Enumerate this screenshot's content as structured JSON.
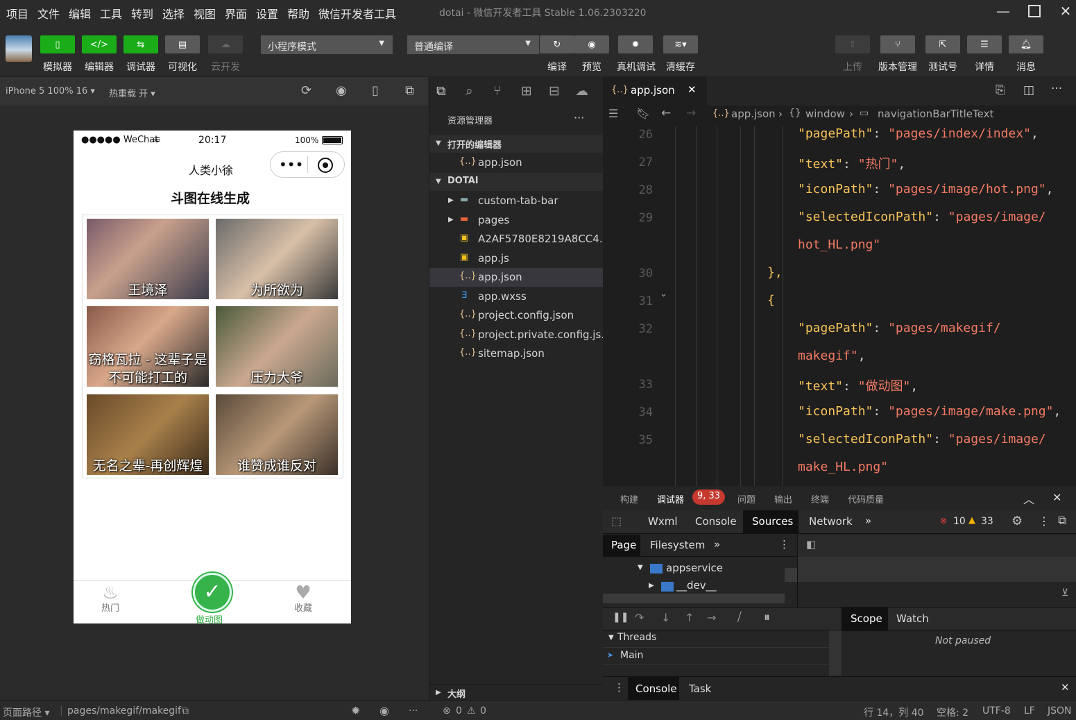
{
  "menu": [
    "项目",
    "文件",
    "编辑",
    "工具",
    "转到",
    "选择",
    "视图",
    "界面",
    "设置",
    "帮助",
    "微信开发者工具"
  ],
  "window_title": "dotai - 微信开发者工具 Stable 1.06.2303220",
  "toolbar": {
    "simulator": "模拟器",
    "editor": "编辑器",
    "debugger": "调试器",
    "visual": "可视化",
    "cloud": "云开发",
    "mode_select": "小程序模式",
    "compile_select": "普通编译",
    "compile": "编译",
    "preview": "预览",
    "remote_debug": "真机调试",
    "clear_cache": "清缓存",
    "upload": "上传",
    "version": "版本管理",
    "test": "测试号",
    "details": "详情",
    "messages": "消息"
  },
  "subbar": {
    "device": "iPhone 5 100% 16 ▾",
    "hotreload": "热重载 开 ▾"
  },
  "phone": {
    "status_left": "●●●●● WeChat",
    "status_time": "20:17",
    "status_battery": "100%",
    "nav_title": "人类小徐",
    "page_title": "斗图在线生成",
    "captions": [
      "王境泽",
      "为所欲为",
      "窃格瓦拉 - 这辈子是不可能打工的",
      "压力大爷",
      "无名之辈-再创辉煌",
      "谁赞成谁反对"
    ],
    "tabs": [
      "热门",
      "做动图",
      "收藏"
    ]
  },
  "explorer": {
    "title": "资源管理器",
    "open_editors": "打开的编辑器",
    "open_file": "app.json",
    "project": "DOTAI",
    "files": [
      "custom-tab-bar",
      "pages",
      "A2AF5780E8219A8CC4...",
      "app.js",
      "app.json",
      "app.wxss",
      "project.config.json",
      "project.private.config.js...",
      "sitemap.json"
    ],
    "outline": "大纲"
  },
  "editor": {
    "tab": "app.json",
    "breadcrumb": [
      "app.json",
      "window",
      "navigationBarTitleText"
    ],
    "lines": [
      {
        "n": "26",
        "parts": [
          [
            "k",
            "\"pagePath\""
          ],
          [
            "p",
            ": "
          ],
          [
            "s",
            "\"pages/index/index\""
          ],
          [
            "p",
            ","
          ]
        ]
      },
      {
        "n": "27",
        "parts": [
          [
            "k",
            "\"text\""
          ],
          [
            "p",
            ": "
          ],
          [
            "s",
            "\"热门\""
          ],
          [
            "p",
            ","
          ]
        ]
      },
      {
        "n": "28",
        "parts": [
          [
            "k",
            "\"iconPath\""
          ],
          [
            "p",
            ": "
          ],
          [
            "s",
            "\"pages/image/hot.png\""
          ],
          [
            "p",
            ","
          ]
        ]
      },
      {
        "n": "29",
        "parts": [
          [
            "k",
            "\"selectedIconPath\""
          ],
          [
            "p",
            ": "
          ],
          [
            "s",
            "\"pages/image/"
          ]
        ]
      },
      {
        "n": "",
        "parts": [
          [
            "s",
            "hot_HL.png\""
          ]
        ]
      },
      {
        "n": "30",
        "parts": [
          [
            "k",
            "},"
          ]
        ]
      },
      {
        "n": "31",
        "parts": [
          [
            "k",
            "{"
          ]
        ]
      },
      {
        "n": "32",
        "parts": [
          [
            "k",
            "\"pagePath\""
          ],
          [
            "p",
            ": "
          ],
          [
            "s",
            "\"pages/makegif/"
          ]
        ]
      },
      {
        "n": "",
        "parts": [
          [
            "s",
            "makegif\""
          ],
          [
            "p",
            ","
          ]
        ]
      },
      {
        "n": "33",
        "parts": [
          [
            "k",
            "\"text\""
          ],
          [
            "p",
            ": "
          ],
          [
            "s",
            "\"做动图\""
          ],
          [
            "p",
            ","
          ]
        ]
      },
      {
        "n": "34",
        "parts": [
          [
            "k",
            "\"iconPath\""
          ],
          [
            "p",
            ": "
          ],
          [
            "s",
            "\"pages/image/make.png\""
          ],
          [
            "p",
            ","
          ]
        ]
      },
      {
        "n": "35",
        "parts": [
          [
            "k",
            "\"selectedIconPath\""
          ],
          [
            "p",
            ": "
          ],
          [
            "s",
            "\"pages/image/"
          ]
        ]
      },
      {
        "n": "",
        "parts": [
          [
            "s",
            "make_HL.png\""
          ]
        ]
      }
    ]
  },
  "debug": {
    "top_tabs": [
      "构建",
      "调试器",
      "问题",
      "输出",
      "终端",
      "代码质量"
    ],
    "badge": "9, 33",
    "dev_tabs": [
      "Wxml",
      "Console",
      "Sources",
      "Network"
    ],
    "errors": "10",
    "warnings": "33",
    "source_tabs": [
      "Page",
      "Filesystem"
    ],
    "tree": [
      "appservice",
      "__dev__"
    ],
    "threads": "Threads",
    "main": "Main",
    "scope": "Scope",
    "watch": "Watch",
    "not_paused": "Not paused",
    "drawer": [
      "Console",
      "Task"
    ]
  },
  "status": {
    "path_label": "页面路径 ▾",
    "path": "pages/makegif/makegif",
    "err": "0",
    "warn": "0",
    "position": "行 14，列 40",
    "spaces": "空格: 2",
    "encoding": "UTF-8",
    "eol": "LF",
    "lang": "JSON"
  },
  "colors": {
    "green": "#1aad19",
    "key": "#f7c35a",
    "string": "#f27a63"
  }
}
